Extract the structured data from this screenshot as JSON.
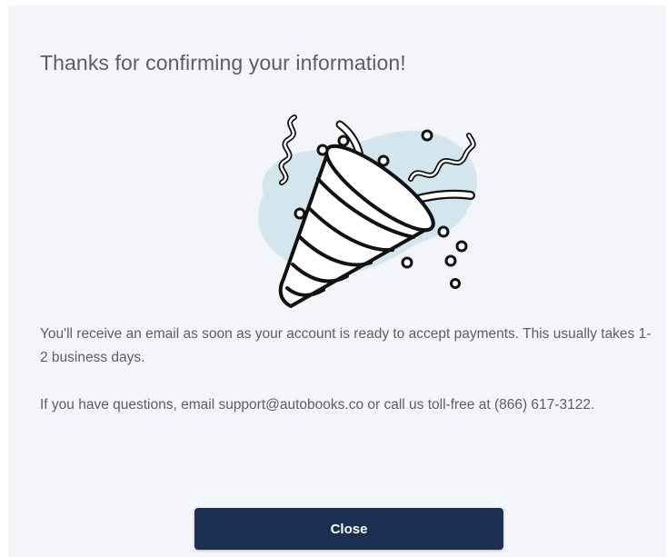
{
  "modal": {
    "title": "Thanks for confirming your information!",
    "illustration_icon": "party-popper-icon",
    "message_1": "You'll receive an email as soon as your account is ready to accept payments. This usually takes 1-2 business days.",
    "message_2": "If you have questions, email support@autobooks.co or call us toll-free at (866) 617-3122.",
    "close_label": "Close"
  },
  "colors": {
    "background": "#f4f5f9",
    "button": "#1b3050",
    "accent_blob": "#d4e6ed",
    "text": "#5b5e66"
  }
}
